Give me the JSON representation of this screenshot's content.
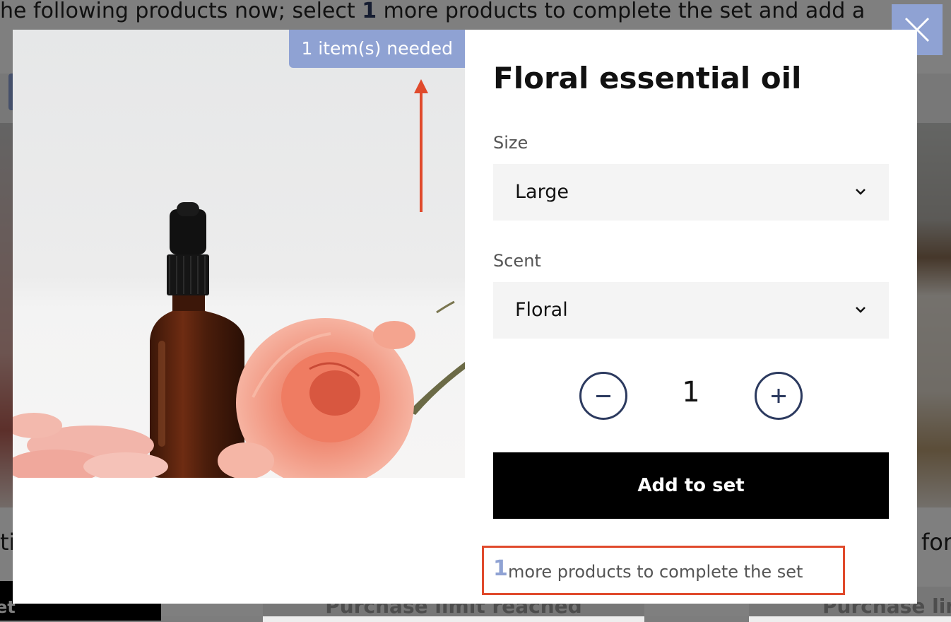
{
  "background": {
    "banner": {
      "before": "he following products now; select ",
      "count": "1",
      "after": " more products to complete the set and add a"
    },
    "left_text": "ti",
    "right_text": "for",
    "left_button": "et",
    "limit_button_1": "Purchase limit reached",
    "limit_button_2": "Purchase lim"
  },
  "modal": {
    "close_icon": "close-icon",
    "badge": "1 item(s) needed",
    "title": "Floral essential oil",
    "size": {
      "label": "Size",
      "value": "Large",
      "icon": "chevron-down-icon"
    },
    "scent": {
      "label": "Scent",
      "value": "Floral",
      "icon": "chevron-down-icon"
    },
    "quantity": {
      "value": "1",
      "decrease_icon": "minus-icon",
      "increase_icon": "plus-icon"
    },
    "add_button": "Add to set",
    "remaining": {
      "count": "1",
      "text": "more products to complete the set"
    }
  },
  "colors": {
    "accent": "#8fa2d3",
    "annotation": "#e04a2c",
    "button": "#000000",
    "stepper_border": "#2c3a5f"
  }
}
